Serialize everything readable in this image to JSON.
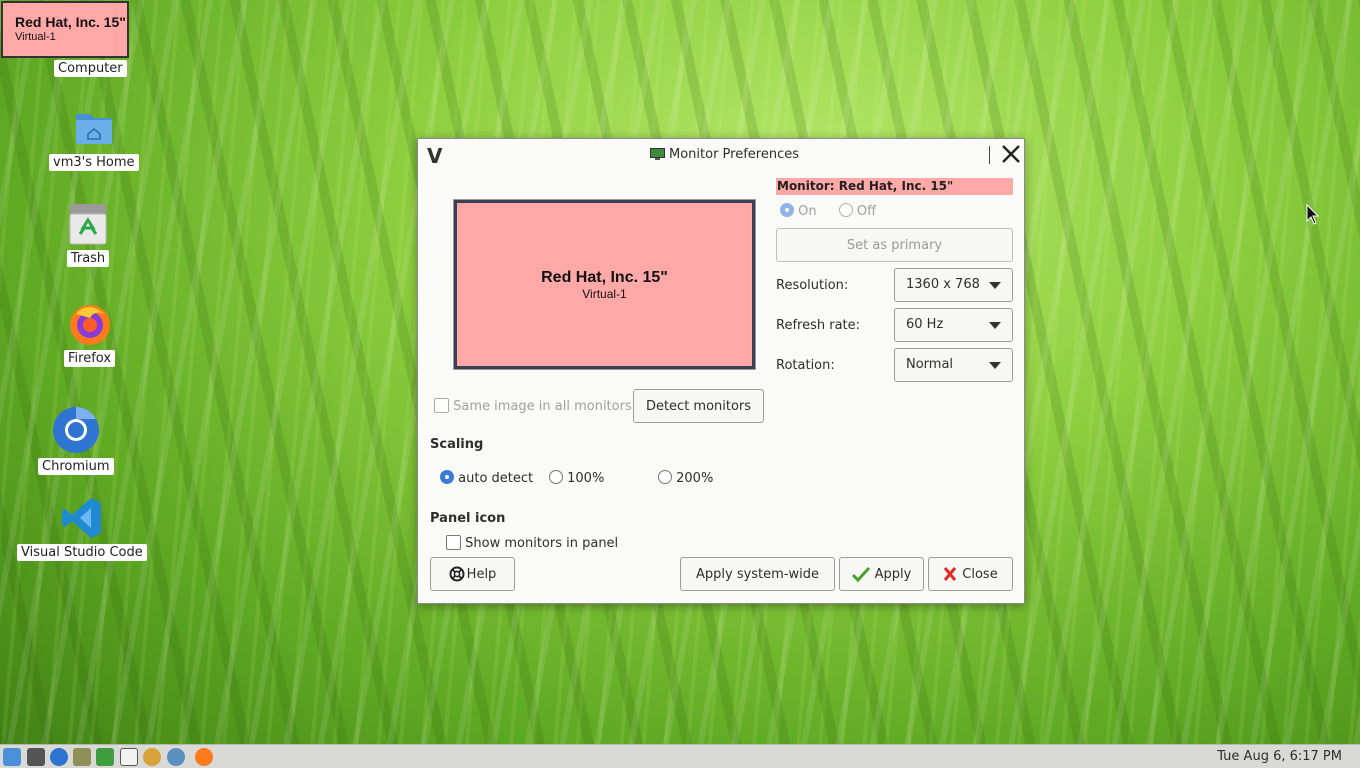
{
  "monitor_label": {
    "name": "Red Hat, Inc. 15\"",
    "output": "Virtual-1"
  },
  "desktop_icons": [
    {
      "label": "Computer",
      "icon": "computer-icon"
    },
    {
      "label": "vm3's Home",
      "icon": "home-folder-icon"
    },
    {
      "label": "Trash",
      "icon": "trash-icon"
    },
    {
      "label": "Firefox",
      "icon": "firefox-icon"
    },
    {
      "label": "Chromium",
      "icon": "chromium-icon"
    },
    {
      "label": "Visual Studio Code",
      "icon": "vscode-icon"
    }
  ],
  "dialog": {
    "title": "Monitor Preferences",
    "preview": {
      "name": "Red Hat, Inc. 15\"",
      "output": "Virtual-1"
    },
    "monitor_heading": "Monitor: Red Hat, Inc. 15\"",
    "power": {
      "on_label": "On",
      "off_label": "Off",
      "selected": "On"
    },
    "set_primary_label": "Set as primary",
    "resolution": {
      "label": "Resolution:",
      "value": "1360 x 768"
    },
    "refresh_rate": {
      "label": "Refresh rate:",
      "value": "60 Hz"
    },
    "rotation": {
      "label": "Rotation:",
      "value": "Normal"
    },
    "same_image_label": "Same image in all monitors",
    "detect_label": "Detect monitors",
    "scaling": {
      "heading": "Scaling",
      "options": [
        "auto detect",
        "100%",
        "200%"
      ],
      "selected": "auto detect"
    },
    "panel_icon": {
      "heading": "Panel icon",
      "show_label": "Show monitors in panel"
    },
    "buttons": {
      "help": "Help",
      "apply_system_wide": "Apply system-wide",
      "apply": "Apply",
      "close": "Close"
    }
  },
  "taskbar": {
    "clock": "Tue Aug  6,  6:17 PM"
  },
  "colors": {
    "monitor_highlight": "#ffa8a8",
    "radio_selected": "#3c7ad6"
  }
}
